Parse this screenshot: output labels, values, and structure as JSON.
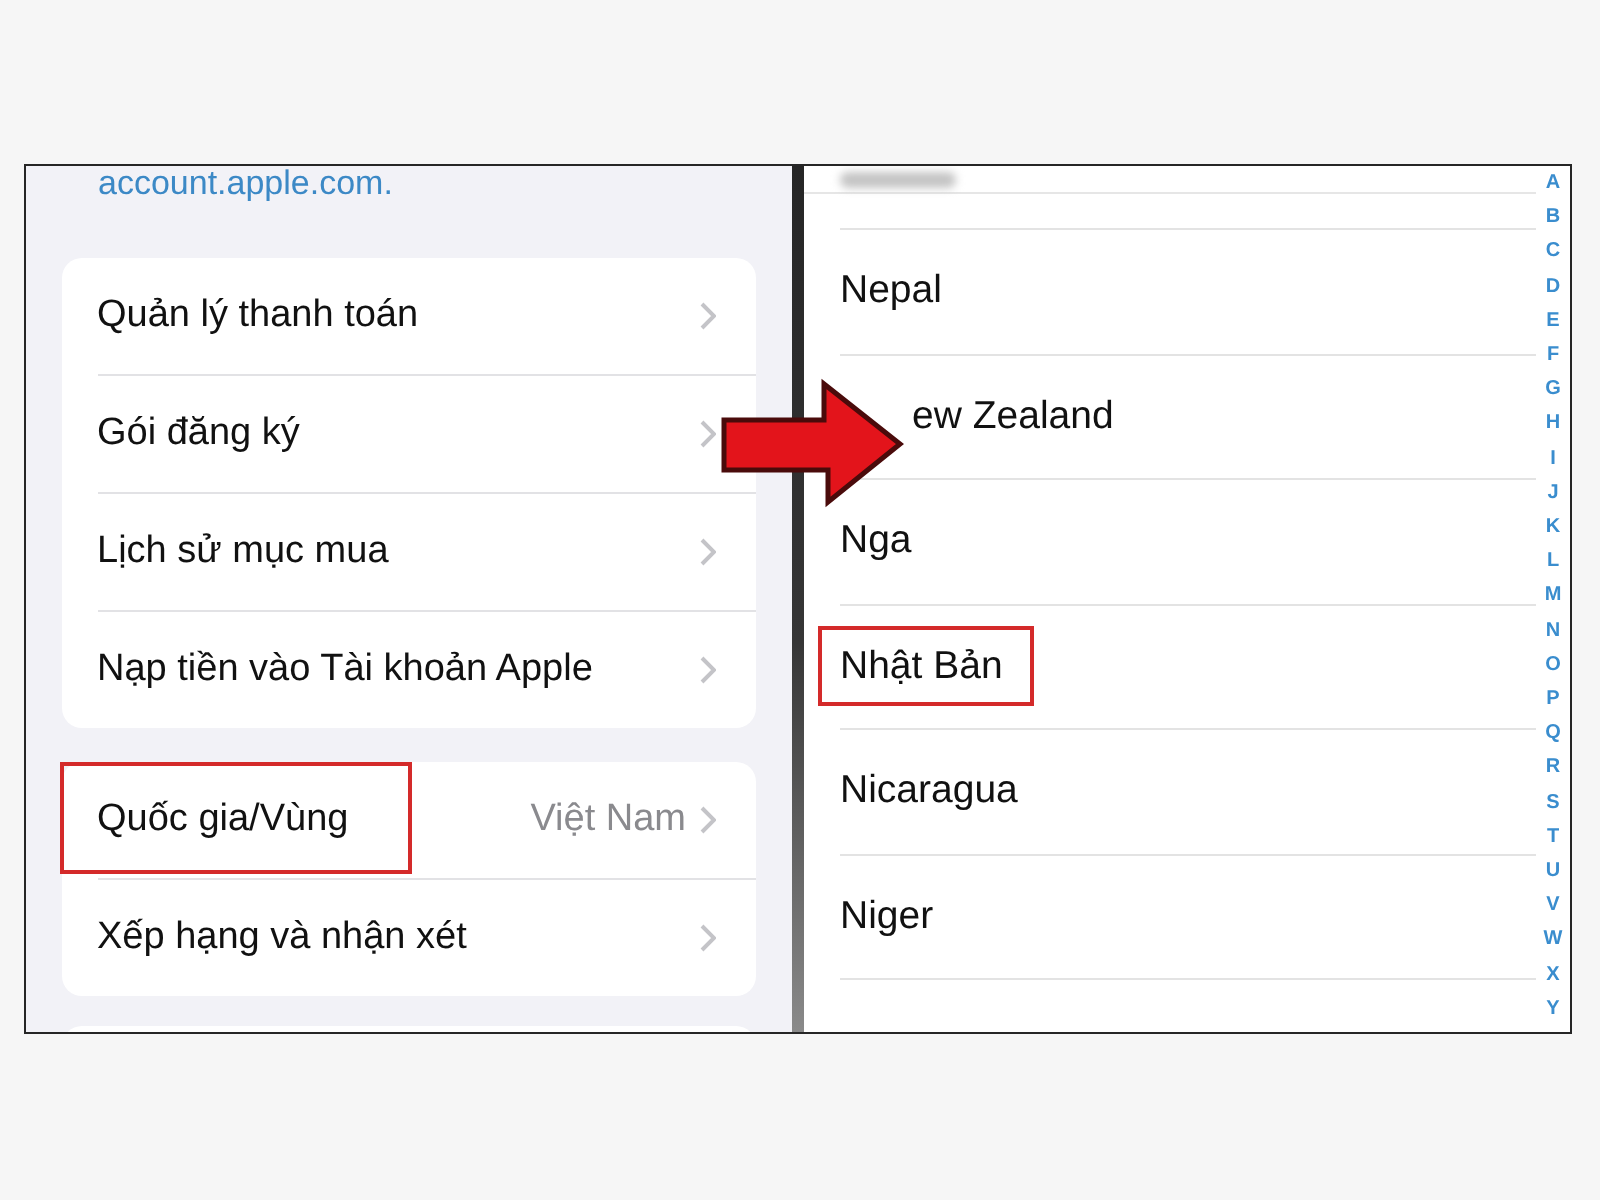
{
  "settings": {
    "link": "account.apple.com.",
    "groups": [
      {
        "rows": [
          {
            "label": "Quản lý thanh toán",
            "highlighted": false
          },
          {
            "label": "Gói đăng ký",
            "highlighted": false
          },
          {
            "label": "Lịch sử mục mua",
            "highlighted": false
          },
          {
            "label": "Nạp tiền vào Tài khoản Apple",
            "highlighted": false
          }
        ]
      },
      {
        "rows": [
          {
            "label": "Quốc gia/Vùng",
            "value": "Việt Nam",
            "highlighted": true
          },
          {
            "label": "Xếp hạng và nhận xét",
            "highlighted": false
          }
        ]
      }
    ]
  },
  "country_list": {
    "countries": [
      {
        "name": "Nepal",
        "kind": "plain",
        "highlighted": false
      },
      {
        "name": "ew Zealand",
        "kind": "covered",
        "highlighted": false
      },
      {
        "name": "Nga",
        "kind": "plain",
        "highlighted": false
      },
      {
        "name": "Nhật Bản",
        "kind": "plain",
        "highlighted": true
      },
      {
        "name": "Nicaragua",
        "kind": "plain",
        "highlighted": false
      },
      {
        "name": "Niger",
        "kind": "plain",
        "highlighted": false
      }
    ],
    "index": [
      "A",
      "B",
      "C",
      "D",
      "E",
      "F",
      "G",
      "H",
      "I",
      "J",
      "K",
      "L",
      "M",
      "N",
      "O",
      "P",
      "Q",
      "R",
      "S",
      "T",
      "U",
      "V",
      "W",
      "X",
      "Y"
    ]
  }
}
